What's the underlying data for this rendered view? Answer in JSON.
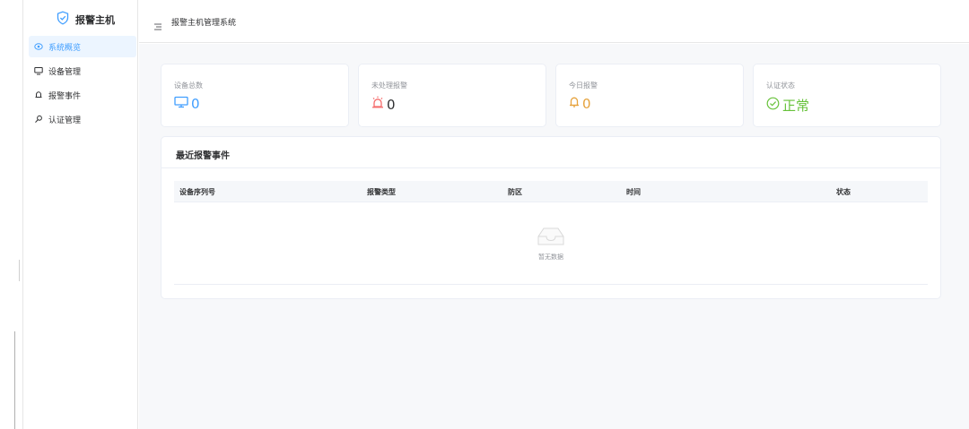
{
  "sidebar": {
    "logo_title": "报警主机",
    "items": [
      {
        "label": "系统概览",
        "active": true
      },
      {
        "label": "设备管理",
        "active": false
      },
      {
        "label": "报警事件",
        "active": false
      },
      {
        "label": "认证管理",
        "active": false
      }
    ]
  },
  "header": {
    "title": "报警主机管理系统"
  },
  "stats": [
    {
      "label": "设备总数",
      "value": "0",
      "icon": "monitor-icon",
      "color": "#409eff"
    },
    {
      "label": "未处理报警",
      "value": "0",
      "icon": "alarm-light-icon",
      "color": "#f56c6c"
    },
    {
      "label": "今日报警",
      "value": "0",
      "icon": "bell-icon",
      "color": "#e6a23c"
    },
    {
      "label": "认证状态",
      "value": "正常",
      "icon": "check-circle-icon",
      "color": "#67c23a"
    }
  ],
  "recent_events": {
    "title": "最近报警事件",
    "columns": [
      "设备序列号",
      "报警类型",
      "防区",
      "时间",
      "状态"
    ],
    "rows": [],
    "empty_text": "暂无数据"
  },
  "colors": {
    "primary": "#409eff",
    "danger": "#f56c6c",
    "warning": "#e6a23c",
    "success": "#67c23a",
    "active_bg": "#ecf5ff"
  }
}
